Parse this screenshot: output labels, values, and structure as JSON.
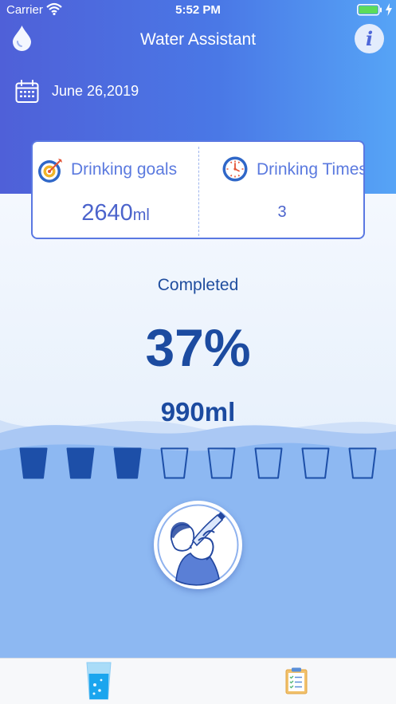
{
  "status_bar": {
    "carrier": "Carrier",
    "time": "5:52 PM"
  },
  "header": {
    "title": "Water Assistant",
    "info_label": "i",
    "date": "June 26,2019"
  },
  "stats": {
    "goal_label": "Drinking goals",
    "goal_value": "2640",
    "goal_unit": "ml",
    "times_label": "Drinking Times",
    "times_value": "3"
  },
  "progress": {
    "completed_label": "Completed",
    "percent": "37%",
    "amount": "990ml",
    "cups_total": 8,
    "cups_filled": 3
  },
  "colors": {
    "header_start": "#4f60d8",
    "header_end": "#56a4f6",
    "accent": "#1c4ba0",
    "cup_filled": "#1d4fa8",
    "card_border": "#5a78e2"
  },
  "icons": {
    "drop": "drop-icon",
    "info": "info-icon",
    "calendar": "calendar-icon",
    "goal": "target-icon",
    "times": "clock-icon",
    "drink": "drinking-person-icon",
    "tab_home": "water-glass-icon",
    "tab_records": "clipboard-icon"
  }
}
